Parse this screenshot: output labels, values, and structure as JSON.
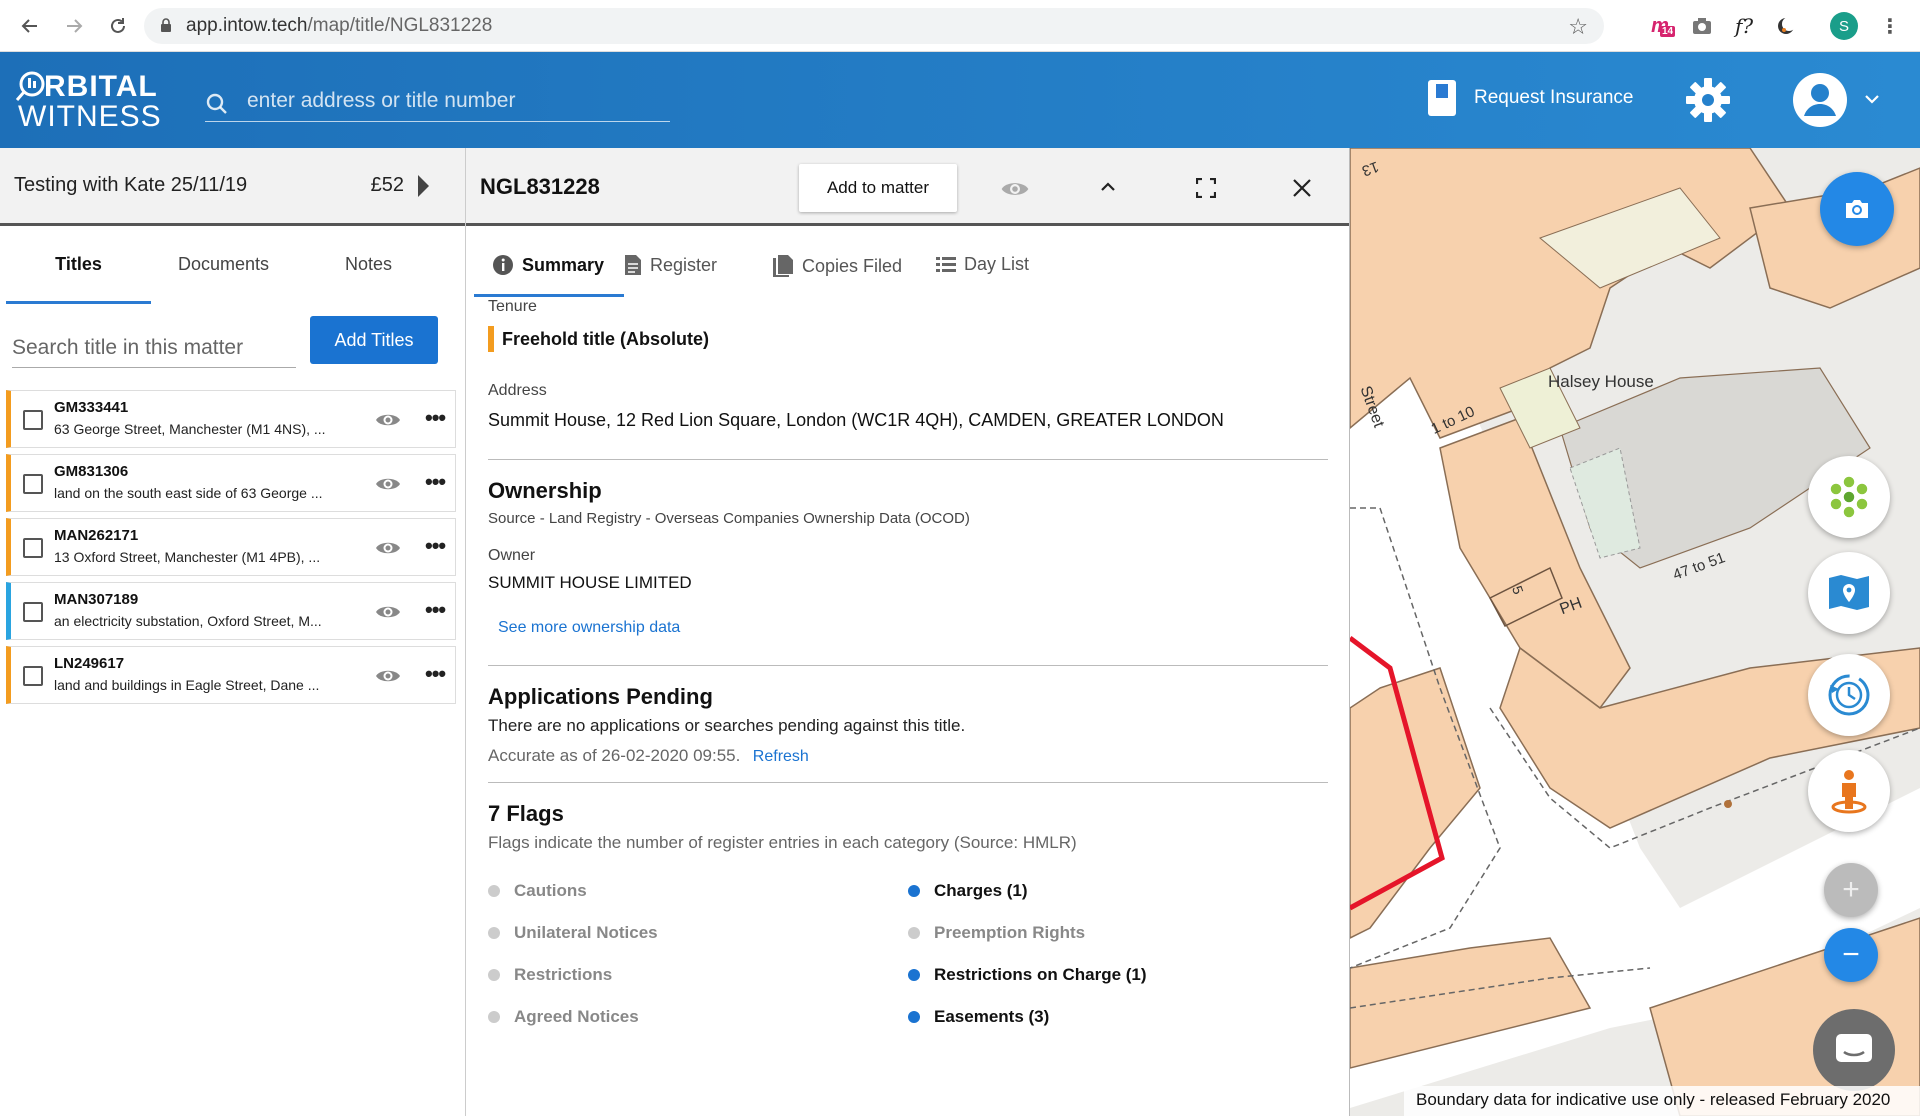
{
  "browser": {
    "url_host": "app.intow.tech",
    "url_path": "/map/title/NGL831228",
    "profile_initial": "S",
    "ext_badge": "14"
  },
  "header": {
    "logo_line1": "RBITAL",
    "logo_line2": "WITNESS",
    "search_placeholder": "enter address or title number",
    "request_insurance": "Request Insurance"
  },
  "matter": {
    "name": "Testing with Kate 25/11/19",
    "price": "£52"
  },
  "left_tabs": [
    "Titles",
    "Documents",
    "Notes"
  ],
  "left_search_placeholder": "Search title in this matter",
  "add_titles_label": "Add Titles",
  "titles": [
    {
      "number": "GM333441",
      "address": "63 George Street, Manchester (M1 4NS), ...",
      "tenure_color": "#f39c1f"
    },
    {
      "number": "GM831306",
      "address": "land on the south east side of 63 George ...",
      "tenure_color": "#f39c1f"
    },
    {
      "number": "MAN262171",
      "address": "13 Oxford Street, Manchester (M1 4PB), ...",
      "tenure_color": "#f39c1f"
    },
    {
      "number": "MAN307189",
      "address": "an electricity substation, Oxford Street, M...",
      "tenure_color": "#2aa4e0"
    },
    {
      "number": "LN249617",
      "address": "land and buildings in Eagle Street, Dane ...",
      "tenure_color": "#f39c1f"
    }
  ],
  "detail": {
    "title_number": "NGL831228",
    "add_to_matter": "Add to matter",
    "tabs": [
      "Summary",
      "Register",
      "Copies Filed",
      "Day List"
    ],
    "tenure_label": "Tenure",
    "tenure_value": "Freehold title (Absolute)",
    "address_label": "Address",
    "address_value": "Summit House, 12 Red Lion Square, London (WC1R 4QH), CAMDEN, GREATER LONDON",
    "ownership_heading": "Ownership",
    "ownership_source": "Source - Land Registry - Overseas Companies Ownership Data (OCOD)",
    "owner_label": "Owner",
    "owner_value": "SUMMIT HOUSE LIMITED",
    "see_more": "See more ownership data",
    "apps_heading": "Applications Pending",
    "apps_text": "There are no applications or searches pending against this title.",
    "accurate_text": "Accurate as of 26-02-2020 09:55.",
    "refresh": "Refresh",
    "flags_heading": "7 Flags",
    "flags_sub": "Flags indicate the number of register entries in each category (Source: HMLR)",
    "flags_left": [
      {
        "label": "Cautions",
        "active": false
      },
      {
        "label": "Unilateral Notices",
        "active": false
      },
      {
        "label": "Restrictions",
        "active": false
      },
      {
        "label": "Agreed Notices",
        "active": false
      }
    ],
    "flags_right": [
      {
        "label": "Charges (1)",
        "active": true
      },
      {
        "label": "Preemption Rights",
        "active": false
      },
      {
        "label": "Restrictions on Charge (1)",
        "active": true
      },
      {
        "label": "Easements (3)",
        "active": true
      }
    ]
  },
  "map": {
    "labels": {
      "halsey": "Halsey House",
      "one_to_ten": "1 to 10",
      "street": "Street",
      "num47": "47 to 51",
      "ph": "PH",
      "n5": "5",
      "n13": "13"
    },
    "attribution": "Boundary data for indicative use only - released February 2020",
    "zoom_in": "+",
    "zoom_out": "−"
  }
}
